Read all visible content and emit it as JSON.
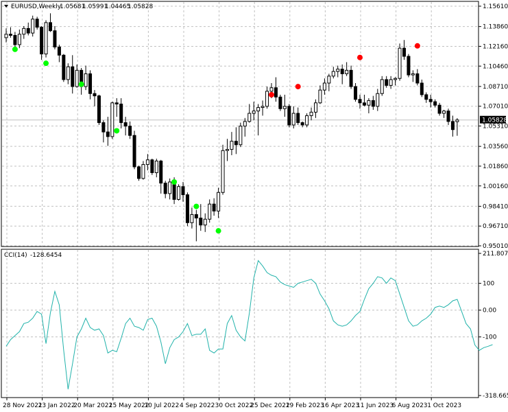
{
  "chart_data": [
    {
      "type": "candlestick",
      "symbol": "EURUSD,Weekly",
      "header_values": [
        "1.05681",
        "1.05991",
        "1.04465",
        "1.05828"
      ],
      "current_price_label": "1.05828",
      "current_price": 1.05828,
      "ylim": [
        0.9501,
        1.1561
      ],
      "ytick_labels": [
        "1.15610",
        "1.13860",
        "1.12160",
        "1.10460",
        "1.08710",
        "1.07010",
        "1.05310",
        "1.03560",
        "1.01860",
        "1.00160",
        "0.98410",
        "0.96710",
        "0.95010"
      ],
      "yticks": [
        1.1561,
        1.1386,
        1.1216,
        1.1046,
        1.0871,
        1.0701,
        1.0531,
        1.0356,
        1.0186,
        1.0016,
        0.9841,
        0.9671,
        0.9501
      ],
      "grid": true,
      "candles": [
        [
          1.129,
          1.137,
          1.125,
          1.132
        ],
        [
          1.132,
          1.138,
          1.129,
          1.131
        ],
        [
          1.131,
          1.134,
          1.121,
          1.123
        ],
        [
          1.123,
          1.136,
          1.12,
          1.132
        ],
        [
          1.132,
          1.139,
          1.128,
          1.137
        ],
        [
          1.137,
          1.142,
          1.131,
          1.133
        ],
        [
          1.133,
          1.148,
          1.13,
          1.145
        ],
        [
          1.145,
          1.147,
          1.136,
          1.138
        ],
        [
          1.138,
          1.139,
          1.11,
          1.115
        ],
        [
          1.115,
          1.144,
          1.112,
          1.142
        ],
        [
          1.142,
          1.15,
          1.134,
          1.135
        ],
        [
          1.135,
          1.139,
          1.119,
          1.121
        ],
        [
          1.121,
          1.123,
          1.108,
          1.114
        ],
        [
          1.114,
          1.115,
          1.091,
          1.093
        ],
        [
          1.093,
          1.107,
          1.089,
          1.104
        ],
        [
          1.104,
          1.114,
          1.081,
          1.087
        ],
        [
          1.087,
          1.106,
          1.086,
          1.101
        ],
        [
          1.101,
          1.103,
          1.08,
          1.087
        ],
        [
          1.087,
          1.105,
          1.084,
          1.098
        ],
        [
          1.098,
          1.101,
          1.076,
          1.081
        ],
        [
          1.081,
          1.084,
          1.07,
          1.079
        ],
        [
          1.079,
          1.08,
          1.054,
          1.056
        ],
        [
          1.056,
          1.058,
          1.039,
          1.048
        ],
        [
          1.048,
          1.061,
          1.036,
          1.044
        ],
        [
          1.044,
          1.074,
          1.042,
          1.073
        ],
        [
          1.073,
          1.077,
          1.061,
          1.072
        ],
        [
          1.072,
          1.077,
          1.051,
          1.056
        ],
        [
          1.056,
          1.061,
          1.045,
          1.053
        ],
        [
          1.053,
          1.057,
          1.042,
          1.045
        ],
        [
          1.045,
          1.049,
          1.016,
          1.018
        ],
        [
          1.018,
          1.019,
          1.006,
          1.008
        ],
        [
          1.008,
          1.023,
          1.007,
          1.02
        ],
        [
          1.02,
          1.029,
          1.015,
          1.024
        ],
        [
          1.024,
          1.025,
          1.011,
          1.013
        ],
        [
          1.013,
          1.025,
          1.009,
          1.023
        ],
        [
          1.023,
          1.024,
          0.995,
          1.004
        ],
        [
          1.004,
          1.006,
          0.991,
          0.995
        ],
        [
          0.995,
          1.008,
          0.99,
          1.005
        ],
        [
          1.005,
          1.009,
          0.986,
          0.99
        ],
        [
          0.99,
          1.003,
          0.989,
          1.001
        ],
        [
          1.001,
          1.005,
          0.988,
          0.994
        ],
        [
          0.994,
          0.996,
          0.967,
          0.97
        ],
        [
          0.97,
          0.983,
          0.965,
          0.977
        ],
        [
          0.977,
          0.981,
          0.954,
          0.974
        ],
        [
          0.974,
          0.986,
          0.963,
          0.968
        ],
        [
          0.968,
          0.978,
          0.962,
          0.973
        ],
        [
          0.973,
          0.99,
          0.97,
          0.986
        ],
        [
          0.986,
          0.991,
          0.976,
          0.98
        ],
        [
          0.98,
          1.0,
          0.974,
          0.996
        ],
        [
          0.996,
          1.037,
          0.994,
          1.032
        ],
        [
          1.032,
          1.042,
          1.023,
          1.033
        ],
        [
          1.033,
          1.048,
          1.028,
          1.04
        ],
        [
          1.04,
          1.052,
          1.029,
          1.037
        ],
        [
          1.037,
          1.056,
          1.035,
          1.053
        ],
        [
          1.053,
          1.06,
          1.044,
          1.057
        ],
        [
          1.057,
          1.072,
          1.056,
          1.064
        ],
        [
          1.064,
          1.074,
          1.058,
          1.066
        ],
        [
          1.066,
          1.072,
          1.045,
          1.069
        ],
        [
          1.069,
          1.075,
          1.062,
          1.07
        ],
        [
          1.07,
          1.087,
          1.068,
          1.083
        ],
        [
          1.083,
          1.09,
          1.077,
          1.086
        ],
        [
          1.086,
          1.095,
          1.074,
          1.078
        ],
        [
          1.078,
          1.08,
          1.066,
          1.068
        ],
        [
          1.068,
          1.08,
          1.061,
          1.07
        ],
        [
          1.07,
          1.072,
          1.052,
          1.054
        ],
        [
          1.054,
          1.07,
          1.051,
          1.064
        ],
        [
          1.064,
          1.069,
          1.054,
          1.056
        ],
        [
          1.056,
          1.057,
          1.052,
          1.054
        ],
        [
          1.054,
          1.064,
          1.052,
          1.062
        ],
        [
          1.062,
          1.069,
          1.058,
          1.065
        ],
        [
          1.065,
          1.076,
          1.06,
          1.073
        ],
        [
          1.073,
          1.088,
          1.072,
          1.084
        ],
        [
          1.084,
          1.094,
          1.08,
          1.09
        ],
        [
          1.09,
          1.098,
          1.083,
          1.096
        ],
        [
          1.096,
          1.104,
          1.094,
          1.1
        ],
        [
          1.1,
          1.105,
          1.095,
          1.102
        ],
        [
          1.102,
          1.106,
          1.089,
          1.098
        ],
        [
          1.098,
          1.108,
          1.096,
          1.101
        ],
        [
          1.101,
          1.105,
          1.085,
          1.087
        ],
        [
          1.087,
          1.09,
          1.074,
          1.076
        ],
        [
          1.076,
          1.08,
          1.068,
          1.073
        ],
        [
          1.073,
          1.08,
          1.07,
          1.071
        ],
        [
          1.071,
          1.077,
          1.064,
          1.075
        ],
        [
          1.075,
          1.079,
          1.067,
          1.07
        ],
        [
          1.07,
          1.085,
          1.066,
          1.081
        ],
        [
          1.081,
          1.096,
          1.079,
          1.093
        ],
        [
          1.093,
          1.096,
          1.086,
          1.088
        ],
        [
          1.088,
          1.096,
          1.085,
          1.093
        ],
        [
          1.093,
          1.095,
          1.088,
          1.094
        ],
        [
          1.094,
          1.124,
          1.092,
          1.12
        ],
        [
          1.12,
          1.127,
          1.11,
          1.113
        ],
        [
          1.113,
          1.115,
          1.095,
          1.097
        ],
        [
          1.097,
          1.101,
          1.091,
          1.098
        ],
        [
          1.098,
          1.102,
          1.088,
          1.09
        ],
        [
          1.09,
          1.093,
          1.078,
          1.08
        ],
        [
          1.08,
          1.082,
          1.073,
          1.076
        ],
        [
          1.076,
          1.08,
          1.069,
          1.074
        ],
        [
          1.074,
          1.076,
          1.069,
          1.071
        ],
        [
          1.071,
          1.073,
          1.062,
          1.064
        ],
        [
          1.064,
          1.067,
          1.06,
          1.066
        ],
        [
          1.066,
          1.068,
          1.054,
          1.057
        ],
        [
          1.057,
          1.062,
          1.044,
          1.05
        ],
        [
          1.0568,
          1.0599,
          1.0447,
          1.0583
        ]
      ],
      "green_signals": [
        [
          2,
          1.119
        ],
        [
          9,
          1.107
        ],
        [
          17,
          1.089
        ],
        [
          25,
          1.049
        ],
        [
          38,
          1.005
        ],
        [
          43,
          0.984
        ],
        [
          48,
          0.963
        ]
      ],
      "red_signals": [
        [
          60,
          1.08
        ],
        [
          66,
          1.087
        ],
        [
          80,
          1.112
        ],
        [
          93,
          1.122
        ]
      ],
      "colors": {
        "bull_body": "#ffffff",
        "bear_body": "#000000",
        "wick": "#000000",
        "green_signal": "#00ff00",
        "red_signal": "#ff0000",
        "grid": "#c0c0c0",
        "price_line": "#c0c0c0"
      }
    },
    {
      "type": "line",
      "name": "CCI(14)",
      "value_label": "-128.6454",
      "ylim": [
        -318.6657,
        211.8076
      ],
      "ytick_labels": [
        "211.8076",
        "100",
        "0.00",
        "-100",
        "-318.6657"
      ],
      "yticks": [
        211.8076,
        100,
        0,
        -100,
        -318.6657
      ],
      "level_lines": [
        100,
        -100
      ],
      "color": "#20b2aa",
      "values": [
        -135,
        -110,
        -95,
        -80,
        -50,
        -45,
        -30,
        -5,
        -15,
        -125,
        -10,
        70,
        20,
        -150,
        -295,
        -200,
        -100,
        -70,
        -30,
        -65,
        -75,
        -70,
        -95,
        -160,
        -150,
        -155,
        -105,
        -50,
        -30,
        -60,
        -65,
        -75,
        -35,
        -30,
        -60,
        -120,
        -200,
        -140,
        -110,
        -100,
        -80,
        -50,
        -95,
        -90,
        -90,
        -70,
        -150,
        -160,
        -145,
        -145,
        -50,
        -20,
        -75,
        -100,
        -115,
        -10,
        120,
        185,
        165,
        140,
        130,
        125,
        105,
        95,
        90,
        85,
        100,
        105,
        110,
        115,
        100,
        60,
        35,
        5,
        -40,
        -55,
        -60,
        -55,
        -40,
        -20,
        -5,
        40,
        80,
        100,
        125,
        120,
        100,
        120,
        110,
        60,
        10,
        -40,
        -60,
        -55,
        -40,
        -30,
        -15,
        10,
        15,
        10,
        20,
        35,
        40,
        -5,
        -50,
        -70,
        -130,
        -150,
        -140,
        -135,
        -128.6454
      ]
    }
  ],
  "x_axis": {
    "labels": [
      "28 Nov 2021",
      "23 Jan 2022",
      "20 Mar 2022",
      "15 May 2022",
      "10 Jul 2022",
      "4 Sep 2022",
      "30 Oct 2022",
      "25 Dec 2022",
      "19 Feb 2023",
      "16 Apr 2023",
      "11 Jun 2023",
      "6 Aug 2023",
      "1 Oct 2023"
    ]
  }
}
